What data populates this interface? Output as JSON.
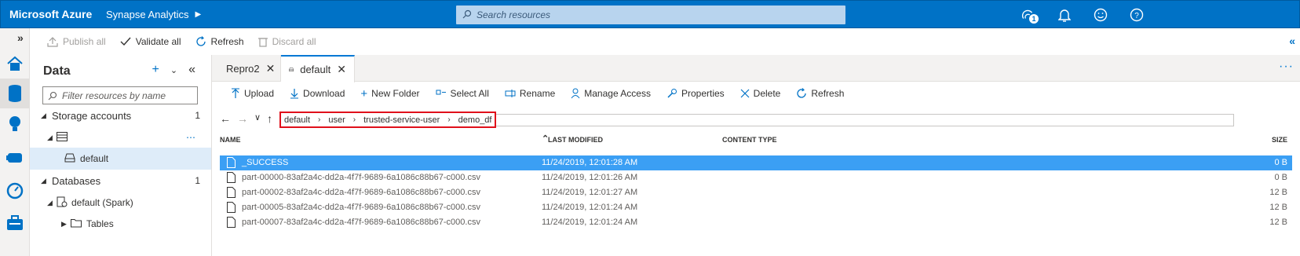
{
  "topbar": {
    "brand": "Microsoft Azure",
    "service": "Synapse Analytics",
    "search_placeholder": "Search resources",
    "notification_badge": "1"
  },
  "commands": {
    "publish_all": "Publish all",
    "validate_all": "Validate all",
    "refresh": "Refresh",
    "discard_all": "Discard all"
  },
  "data_panel": {
    "title": "Data",
    "filter_placeholder": "Filter resources by name",
    "storage_accounts": {
      "label": "Storage accounts",
      "count": "1"
    },
    "storage_child": "default",
    "databases": {
      "label": "Databases",
      "count": "1"
    },
    "database_child": "default (Spark)",
    "tables_label": "Tables"
  },
  "tabs": [
    {
      "label": "Repro2"
    },
    {
      "label": "default"
    }
  ],
  "file_toolbar": {
    "upload": "Upload",
    "download": "Download",
    "new_folder": "New Folder",
    "select_all": "Select All",
    "rename": "Rename",
    "manage_access": "Manage Access",
    "properties": "Properties",
    "delete": "Delete",
    "refresh": "Refresh"
  },
  "breadcrumb": [
    "default",
    "user",
    "trusted-service-user",
    "demo_df"
  ],
  "table": {
    "columns": {
      "name": "NAME",
      "last_modified": "LAST MODIFIED",
      "content_type": "CONTENT TYPE",
      "size": "SIZE"
    },
    "rows": [
      {
        "name": "_SUCCESS",
        "modified": "11/24/2019, 12:01:28 AM",
        "type": "",
        "size": "0 B"
      },
      {
        "name": "part-00000-83af2a4c-dd2a-4f7f-9689-6a1086c88b67-c000.csv",
        "modified": "11/24/2019, 12:01:26 AM",
        "type": "",
        "size": "0 B"
      },
      {
        "name": "part-00002-83af2a4c-dd2a-4f7f-9689-6a1086c88b67-c000.csv",
        "modified": "11/24/2019, 12:01:27 AM",
        "type": "",
        "size": "12 B"
      },
      {
        "name": "part-00005-83af2a4c-dd2a-4f7f-9689-6a1086c88b67-c000.csv",
        "modified": "11/24/2019, 12:01:24 AM",
        "type": "",
        "size": "12 B"
      },
      {
        "name": "part-00007-83af2a4c-dd2a-4f7f-9689-6a1086c88b67-c000.csv",
        "modified": "11/24/2019, 12:01:24 AM",
        "type": "",
        "size": "12 B"
      }
    ]
  },
  "colors": {
    "brand_blue": "#0072c6",
    "selection": "#3b9ff4",
    "highlight_border": "#e0101b"
  }
}
